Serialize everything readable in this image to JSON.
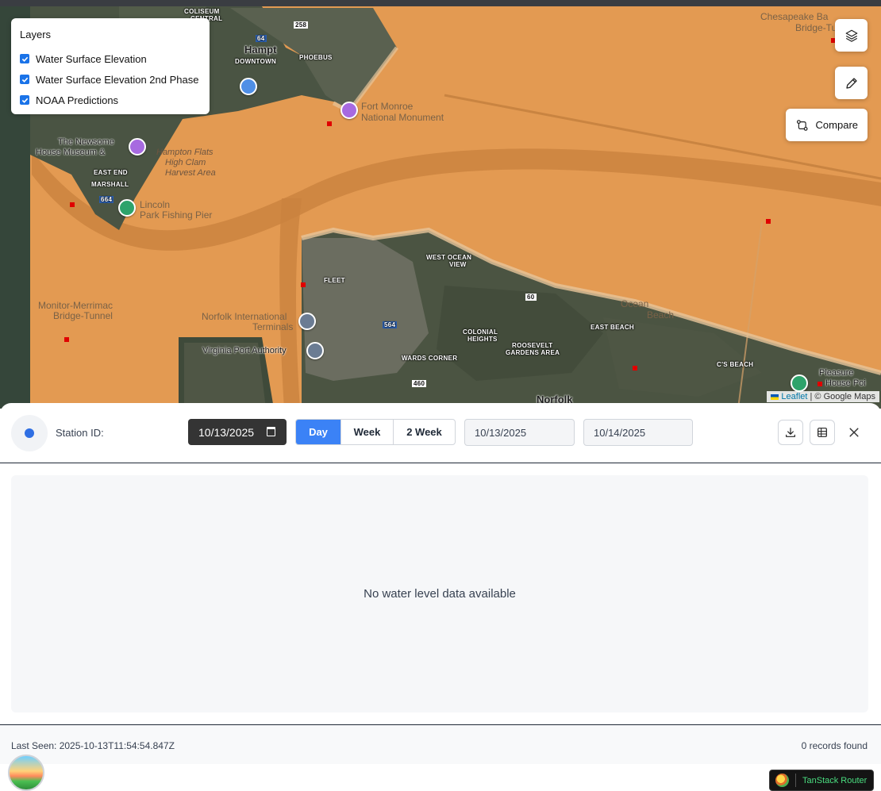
{
  "map": {
    "layers_panel": {
      "title": "Layers",
      "items": [
        {
          "label": "Water Surface Elevation",
          "checked": true
        },
        {
          "label": "Water Surface Elevation 2nd Phase",
          "checked": true
        },
        {
          "label": "NOAA Predictions",
          "checked": true
        }
      ]
    },
    "controls": {
      "layers_icon": "layers-icon",
      "draw_icon": "pencil-icon",
      "compare_label": "Compare"
    },
    "labels": {
      "hampton": "Hampt",
      "downtown": "DOWNTOWN",
      "phoebus": "PHOEBUS",
      "coliseum": "COLISEUM",
      "central": "CENTRAL",
      "fort_monroe": "Fort Monroe",
      "nat_monument": "National Monument",
      "newsome": "The Newsome",
      "house_museum": "House Museum &",
      "east_end": "EAST END",
      "marshall": "MARSHALL",
      "hampton_flats": "Hampton Flats",
      "high_clam": "High Clam",
      "harvest_area": "Harvest Area",
      "lincoln": "Lincoln",
      "park_pier": "Park Fishing Pier",
      "west_ocean_view": "WEST OCEAN",
      "view": "VIEW",
      "fleet": "FLEET",
      "norfolk_intl": "Norfolk International",
      "terminals": "Terminals",
      "virginia_port": "Virginia Port Authority",
      "monitor": "Monitor-Merrimac",
      "bridge_tunnel": "Bridge-Tunnel",
      "colonial": "COLONIAL",
      "heights": "HEIGHTS",
      "roosevelt": "ROOSEVELT",
      "gardens_area": "GARDENS AREA",
      "wards_corner": "WARDS CORNER",
      "east_beach": "EAST BEACH",
      "ocean_view_beach": "Ocean",
      "beach": "Beach",
      "cs_beach": "C'S BEACH",
      "norfolk": "Norfolk",
      "chesapeake": "Chesapeake Ba",
      "bridge_tunn": "Bridge-Tunn",
      "pleasure": "Pleasure",
      "house_point": "House Poi",
      "hwy_64": "64",
      "hwy_258": "258",
      "hwy_664": "664",
      "hwy_60": "60",
      "hwy_460": "460",
      "hwy_564": "564"
    },
    "attribution": {
      "leaflet": "Leaflet",
      "rest": "| © Google Maps"
    }
  },
  "panel": {
    "station_label": "Station ID:",
    "date_value": "10/13/2025",
    "ranges": [
      {
        "label": "Day",
        "active": true
      },
      {
        "label": "Week",
        "active": false
      },
      {
        "label": "2 Week",
        "active": false
      }
    ],
    "start_date": "10/13/2025",
    "end_date": "10/14/2025",
    "empty_message": "No water level data available",
    "last_seen": "Last Seen: 2025-10-13T11:54:54.847Z",
    "records": "0 records found"
  },
  "devtools": {
    "router_label": "TanStack Router"
  },
  "colors": {
    "water_overlay": "#e39a52",
    "primary": "#3b82f6",
    "station_dot": "#2f6fe3",
    "marker": "#e00000"
  }
}
